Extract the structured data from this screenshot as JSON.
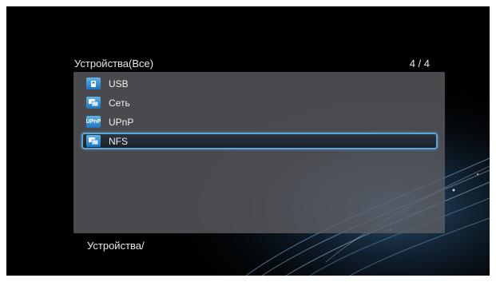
{
  "header": {
    "title": "Устройства(Все)",
    "page_indicator": "4 / 4"
  },
  "devices": [
    {
      "label": "USB",
      "icon": "usb-drive-icon",
      "selected": false
    },
    {
      "label": "Сеть",
      "icon": "network-computer-icon",
      "selected": false
    },
    {
      "label": "UPnP",
      "icon": "upnp-icon",
      "selected": false
    },
    {
      "label": "NFS",
      "icon": "nfs-computer-icon",
      "selected": true
    }
  ],
  "footer": {
    "path": "Устройства/"
  },
  "colors": {
    "background": "#000000",
    "panel": "#5f5f64",
    "selection_border": "#5aa6d6",
    "icon_blue": "#1d75c2"
  }
}
